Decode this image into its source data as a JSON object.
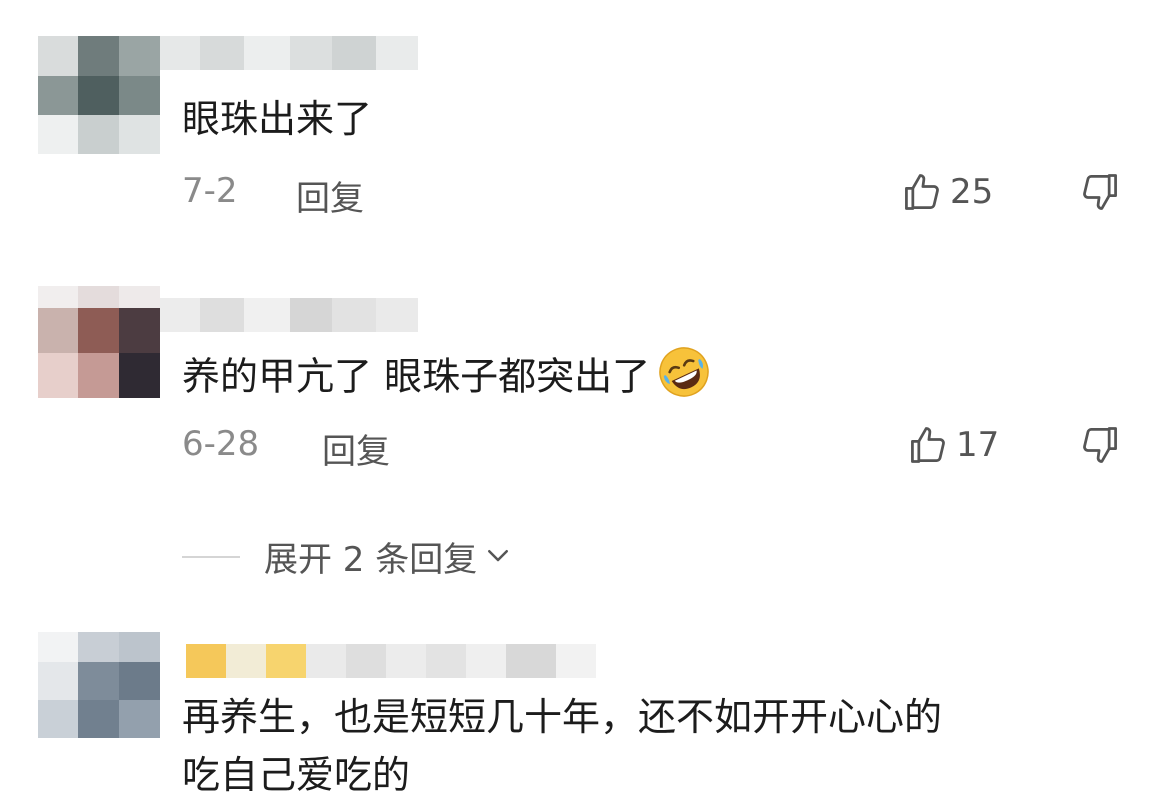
{
  "comments": [
    {
      "text": "眼珠出来了",
      "date": "7-2",
      "reply_label": "回复",
      "likes": "25"
    },
    {
      "text": "养的甲亢了 眼珠子都突出了",
      "emoji": "rolling-on-floor-laughing-emoji",
      "date": "6-28",
      "reply_label": "回复",
      "likes": "17",
      "expand_label": "展开 2 条回复"
    },
    {
      "text_line1": "再养生，也是短短几十年，还不如开开心心的",
      "text_line2": "吃自己爱吃的"
    }
  ],
  "icons": {
    "like": "thumbs-up-outline-icon",
    "dislike": "thumbs-down-outline-icon",
    "expand": "chevron-down-icon"
  },
  "colors": {
    "text": "#1c1c1c",
    "meta": "#8a8a8a",
    "action": "#555555"
  }
}
